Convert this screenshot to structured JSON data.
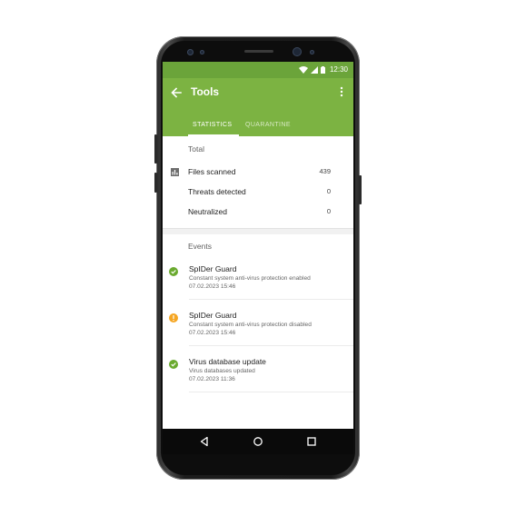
{
  "status_bar": {
    "time": "12:30",
    "icons": [
      "wifi-icon",
      "signal-icon",
      "battery-icon"
    ]
  },
  "app_bar": {
    "title": "Tools",
    "back_icon": "arrow-back-icon",
    "menu_icon": "more-vert-icon"
  },
  "tabs": [
    {
      "label": "STATISTICS",
      "active": true
    },
    {
      "label": "QUARANTINE",
      "active": false
    }
  ],
  "total": {
    "heading": "Total",
    "rows": [
      {
        "label": "Files scanned",
        "value": "439",
        "icon": "bar-chart-icon"
      },
      {
        "label": "Threats detected",
        "value": "0"
      },
      {
        "label": "Neutralized",
        "value": "0"
      }
    ]
  },
  "events": {
    "heading": "Events",
    "items": [
      {
        "title": "SpIDer Guard",
        "description": "Constant system anti-virus protection enabled",
        "time": "07.02.2023 15:46",
        "status": "ok"
      },
      {
        "title": "SpIDer Guard",
        "description": "Constant system anti-virus protection disabled",
        "time": "07.02.2023 15:46",
        "status": "warning"
      },
      {
        "title": "Virus database update",
        "description": "Virus databases updated",
        "time": "07.02.2023 11:36",
        "status": "ok"
      }
    ]
  },
  "nav_bar": {
    "buttons": [
      "back-triangle-icon",
      "home-circle-icon",
      "recents-square-icon"
    ]
  },
  "colors": {
    "primary": "#7cb342",
    "status_bar": "#6ba43a",
    "ok": "#6aaa2f",
    "warning": "#f5a623"
  }
}
